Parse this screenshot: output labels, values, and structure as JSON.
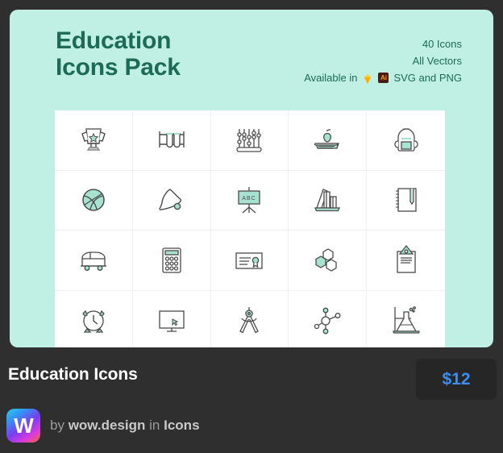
{
  "card": {
    "title": "Education\nIcons Pack",
    "meta": {
      "icon_count": "40 Icons",
      "vectors": "All Vectors",
      "available_prefix": "Available in",
      "sketch_icon": "sketch-diamond-icon",
      "illustrator_icon": "adobe-illustrator-icon",
      "illustrator_label": "Ai",
      "formats": "SVG and PNG"
    },
    "colors": {
      "mint_bg": "#bff0e3",
      "title_green": "#1d6b56",
      "accent_teal": "#9fe0cf",
      "stroke_gray": "#4a4a4a",
      "page_bg": "#2f2f2f",
      "price_blue": "#3b8ef0"
    },
    "grid": {
      "columns": 5,
      "rows": 4,
      "icons": [
        {
          "name": "trophy-icon",
          "label": "Trophy"
        },
        {
          "name": "test-tubes-icon",
          "label": "Test Tubes"
        },
        {
          "name": "abacus-icon",
          "label": "Abacus"
        },
        {
          "name": "apple-on-book-icon",
          "label": "Apple on Book"
        },
        {
          "name": "backpack-icon",
          "label": "Backpack"
        },
        {
          "name": "basketball-icon",
          "label": "Basketball"
        },
        {
          "name": "school-bell-icon",
          "label": "School Bell"
        },
        {
          "name": "abc-board-icon",
          "label": "ABC Board"
        },
        {
          "name": "books-shelf-icon",
          "label": "Books on Shelf"
        },
        {
          "name": "spiral-notebook-icon",
          "label": "Spiral Notebook"
        },
        {
          "name": "school-bus-icon",
          "label": "School Bus"
        },
        {
          "name": "calculator-icon",
          "label": "Calculator"
        },
        {
          "name": "certificate-icon",
          "label": "Certificate"
        },
        {
          "name": "molecule-hexagons-icon",
          "label": "Molecule Hexagons"
        },
        {
          "name": "clipboard-icon",
          "label": "Clipboard"
        },
        {
          "name": "alarm-clock-icon",
          "label": "Alarm Clock"
        },
        {
          "name": "monitor-icon",
          "label": "Monitor"
        },
        {
          "name": "compass-divider-icon",
          "label": "Compass Divider"
        },
        {
          "name": "atom-molecule-icon",
          "label": "Atom Molecule"
        },
        {
          "name": "flask-icon",
          "label": "Flask"
        }
      ]
    }
  },
  "footer": {
    "item_title": "Education Icons",
    "price": "$12",
    "author": {
      "avatar_letter": "W",
      "by_word": "by",
      "author_name": "wow.design",
      "in_word": "in",
      "category": "Icons"
    }
  }
}
